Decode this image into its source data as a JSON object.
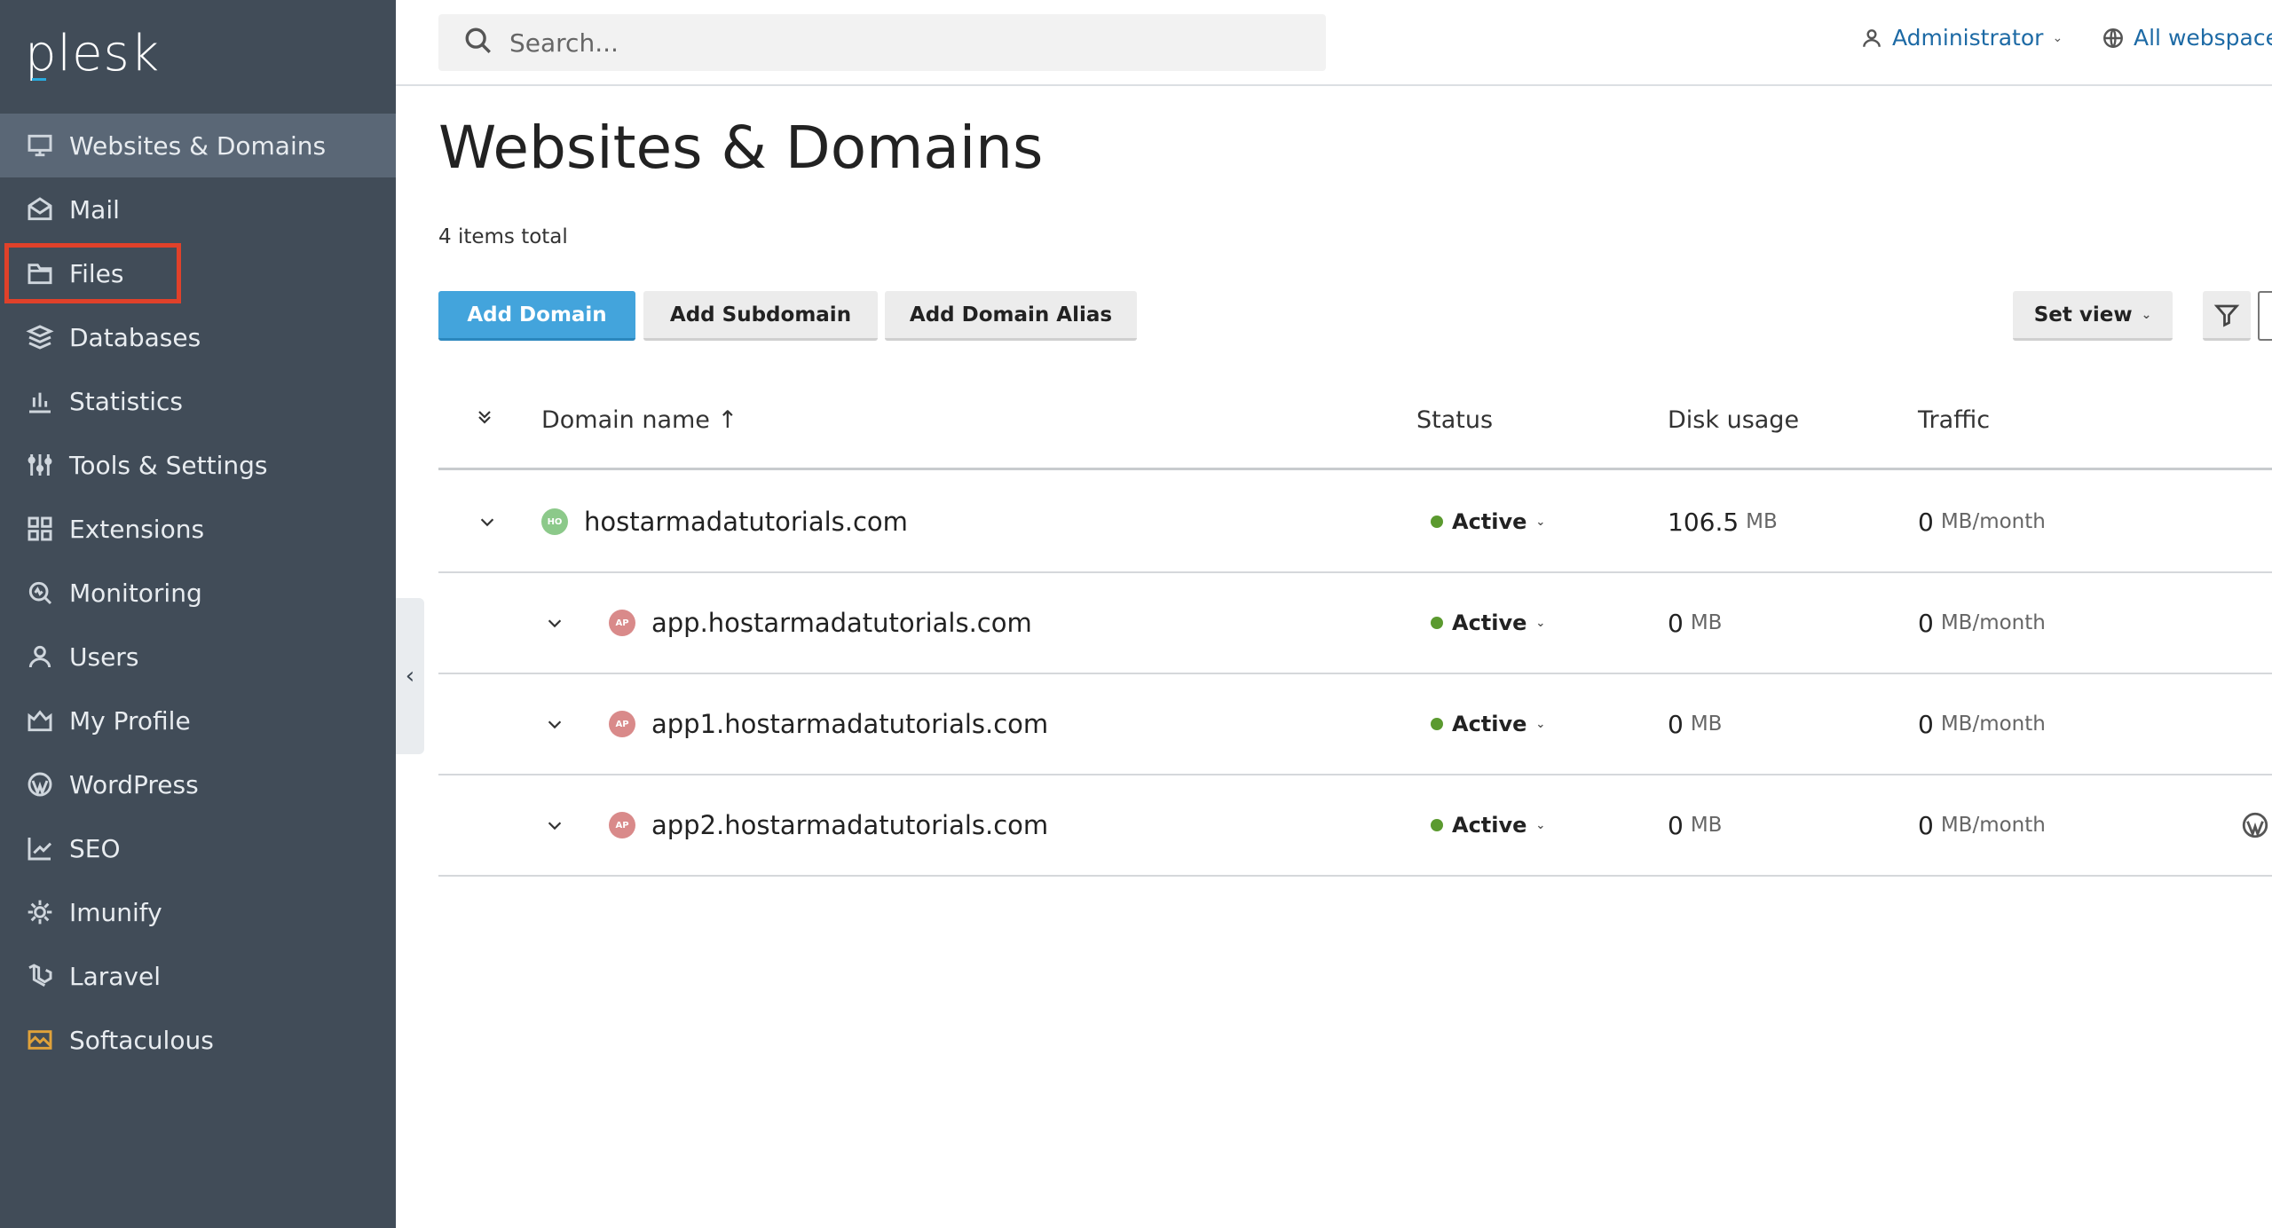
{
  "brand": {
    "logo": "plesk",
    "accent": "#28aade"
  },
  "sidebar": {
    "items": [
      {
        "label": "Websites & Domains",
        "icon": "monitor-icon",
        "active": true
      },
      {
        "label": "Mail",
        "icon": "mail-icon"
      },
      {
        "label": "Files",
        "icon": "folder-icon",
        "highlighted": true
      },
      {
        "label": "Databases",
        "icon": "database-icon"
      },
      {
        "label": "Statistics",
        "icon": "bar-chart-icon"
      },
      {
        "label": "Tools & Settings",
        "icon": "sliders-icon"
      },
      {
        "label": "Extensions",
        "icon": "extensions-icon"
      },
      {
        "label": "Monitoring",
        "icon": "monitoring-icon"
      },
      {
        "label": "Users",
        "icon": "user-icon"
      },
      {
        "label": "My Profile",
        "icon": "profile-icon"
      },
      {
        "label": "WordPress",
        "icon": "wordpress-icon"
      },
      {
        "label": "SEO",
        "icon": "seo-icon"
      },
      {
        "label": "Imunify",
        "icon": "imunify-icon"
      },
      {
        "label": "Laravel",
        "icon": "laravel-icon"
      },
      {
        "label": "Softaculous",
        "icon": "softaculous-icon"
      }
    ],
    "collapse_glyph": "‹"
  },
  "header": {
    "search_placeholder": "Search...",
    "user": "Administrator",
    "webspaces": "All webspaces"
  },
  "main": {
    "title": "Websites & Domains",
    "items_total": "4 items total",
    "buttons": {
      "add_domain": "Add Domain",
      "add_subdomain": "Add Subdomain",
      "add_domain_alias": "Add Domain Alias",
      "set_view": "Set view"
    },
    "table": {
      "columns": {
        "domain": "Domain name ↑",
        "status": "Status",
        "disk": "Disk usage",
        "traffic": "Traffic"
      },
      "rows": [
        {
          "avatar": "HO",
          "avatar_color": "#8cc98a",
          "domain": "hostarmadatutorials.com",
          "status": "Active",
          "disk_value": "106.5",
          "disk_unit": "MB",
          "traffic_value": "0",
          "traffic_unit": "MB/month"
        },
        {
          "avatar": "AP",
          "avatar_color": "#d98a8a",
          "domain": "app.hostarmadatutorials.com",
          "status": "Active",
          "disk_value": "0",
          "disk_unit": "MB",
          "traffic_value": "0",
          "traffic_unit": "MB/month"
        },
        {
          "avatar": "AP",
          "avatar_color": "#d98a8a",
          "domain": "app1.hostarmadatutorials.com",
          "status": "Active",
          "disk_value": "0",
          "disk_unit": "MB",
          "traffic_value": "0",
          "traffic_unit": "MB/month"
        },
        {
          "avatar": "AP",
          "avatar_color": "#d98a8a",
          "domain": "app2.hostarmadatutorials.com",
          "status": "Active",
          "disk_value": "0",
          "disk_unit": "MB",
          "traffic_value": "0",
          "traffic_unit": "MB/month",
          "wordpress": true
        }
      ]
    },
    "status_color": "#5b9a2f"
  }
}
